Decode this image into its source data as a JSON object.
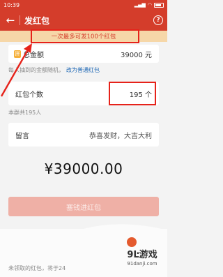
{
  "status_bar": {
    "time": "10:39"
  },
  "app_bar": {
    "title": "发红包",
    "help_label": "?"
  },
  "notice": {
    "text": "一次最多可发100个红包"
  },
  "total": {
    "label": "总金额",
    "value": "39000 元"
  },
  "hint": {
    "text": "每人抽到的金额随机，",
    "link": "改为普通红包"
  },
  "count": {
    "label": "红包个数",
    "value": "195 个",
    "subhint": "本群共195人"
  },
  "message": {
    "label": "留言",
    "value": "恭喜发财，大吉大利"
  },
  "amount": "¥39000.00",
  "submit_label": "塞钱进红包",
  "bottom_note": "未领取的红包，将于24",
  "watermark": {
    "main": "9Ŀ游戏",
    "sub": "91danji.com"
  },
  "colors": {
    "brand_red": "#d43d2b",
    "highlight_box": "#e6221a",
    "notice_bg": "#f6d7a8",
    "link_blue": "#1f68b5"
  }
}
